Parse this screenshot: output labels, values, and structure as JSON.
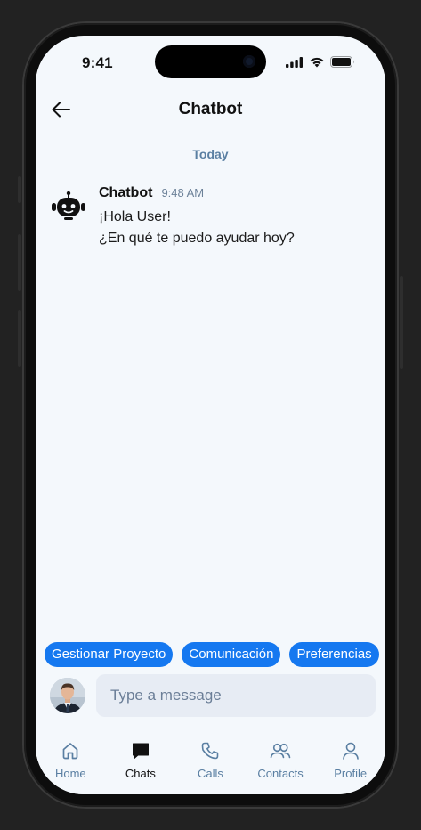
{
  "status_bar": {
    "time": "9:41"
  },
  "header": {
    "title": "Chatbot"
  },
  "date_divider": "Today",
  "message": {
    "sender": "Chatbot",
    "time": "9:48 AM",
    "lines": [
      "¡Hola User!",
      "¿En qué te puedo ayudar hoy?"
    ]
  },
  "quick_replies": [
    "Gestionar Proyecto",
    "Comunicación",
    "Preferencias"
  ],
  "composer": {
    "placeholder": "Type a message"
  },
  "nav": {
    "items": [
      {
        "label": "Home",
        "icon": "home-icon",
        "active": false
      },
      {
        "label": "Chats",
        "icon": "chat-icon",
        "active": true
      },
      {
        "label": "Calls",
        "icon": "phone-icon",
        "active": false
      },
      {
        "label": "Contacts",
        "icon": "contacts-icon",
        "active": false
      },
      {
        "label": "Profile",
        "icon": "profile-icon",
        "active": false
      }
    ]
  },
  "colors": {
    "accent": "#1578f0",
    "muted": "#5a7fa2",
    "background": "#f4f8fc"
  }
}
